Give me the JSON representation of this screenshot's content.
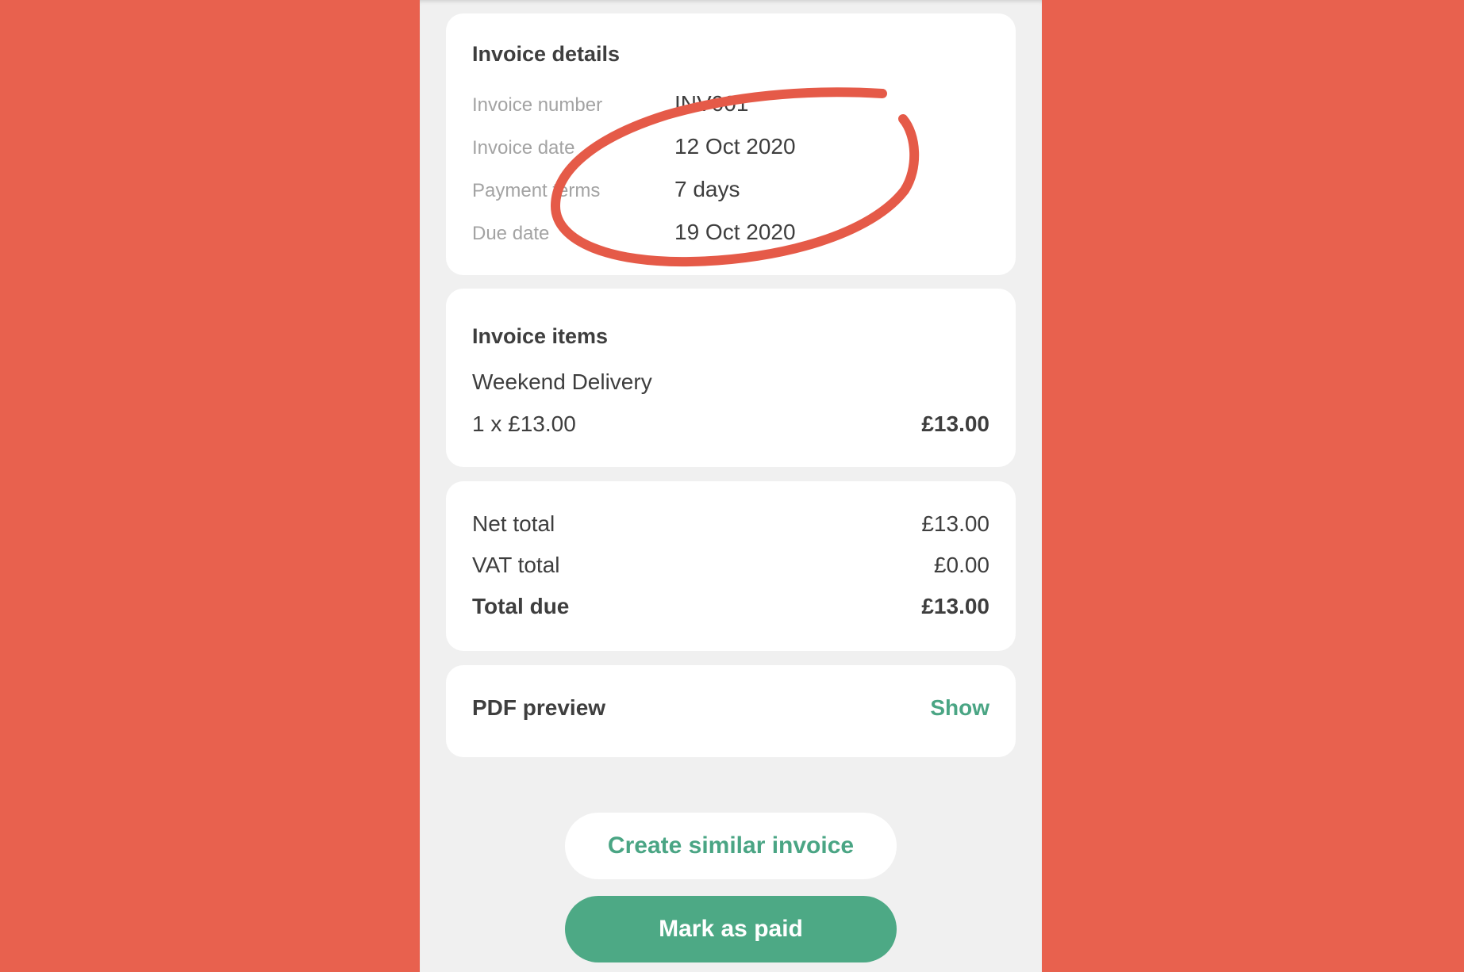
{
  "invoice_details": {
    "title": "Invoice details",
    "rows": [
      {
        "label": "Invoice number",
        "value": "INV001"
      },
      {
        "label": "Invoice date",
        "value": "12 Oct 2020"
      },
      {
        "label": "Payment terms",
        "value": "7 days"
      },
      {
        "label": "Due date",
        "value": "19 Oct 2020"
      }
    ]
  },
  "invoice_items": {
    "title": "Invoice items",
    "items": [
      {
        "name": "Weekend Delivery",
        "quantity_price": "1 x £13.00",
        "amount": "£13.00"
      }
    ]
  },
  "totals": {
    "net_label": "Net total",
    "net_value": "£13.00",
    "vat_label": "VAT total",
    "vat_value": "£0.00",
    "due_label": "Total due",
    "due_value": "£13.00"
  },
  "pdf_preview": {
    "label": "PDF preview",
    "action": "Show"
  },
  "buttons": {
    "create_similar": "Create similar invoice",
    "mark_paid": "Mark as paid"
  },
  "colors": {
    "background": "#E8614E",
    "accent_green": "#4AA584",
    "annotation_red": "#E55A48"
  }
}
